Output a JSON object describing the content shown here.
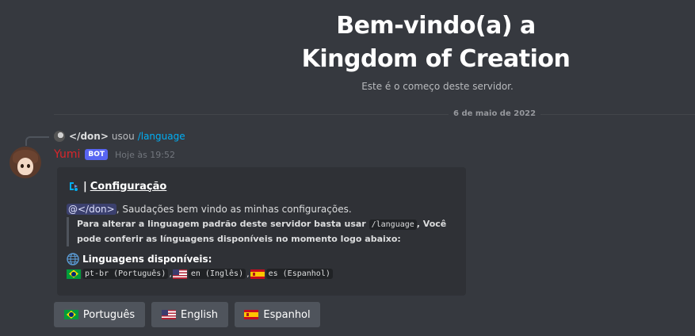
{
  "welcome": {
    "title_line1": "Bem-vindo(a) a",
    "title_line2": "Kingdom of Creation",
    "subtitle": "Este é o começo deste servidor."
  },
  "date_divider": "6 de maio de 2022",
  "reply": {
    "user": "</don>",
    "verb": "usou",
    "command": "/language"
  },
  "message": {
    "author": "Yumi",
    "bot_tag": "BOT",
    "timestamp": "Hoje às 19:52",
    "author_color": "#d9262b"
  },
  "embed": {
    "title_sep": "|",
    "title": "Configuração",
    "mention": "@</don>",
    "greeting": ", Saudações bem vindo as minhas configurações.",
    "quote_part1": "Para alterar a linguagem padrão deste servidor basta usar",
    "quote_code": "/language",
    "quote_part2": ", Você",
    "quote_line2": "pode conferir as línguagens disponíveis no momento logo abaixo:",
    "langs_title": "Linguagens disponíveis:",
    "langs": [
      {
        "code": "pt-br (Português)",
        "flag": "flag-br"
      },
      {
        "code": "en (Inglês)",
        "flag": "flag-us"
      },
      {
        "code": "es (Espanhol)",
        "flag": "flag-es"
      }
    ],
    "langs_sep": ","
  },
  "buttons": [
    {
      "label": "Português",
      "flag": "flag-br"
    },
    {
      "label": "English",
      "flag": "flag-us"
    },
    {
      "label": "Espanhol",
      "flag": "flag-es"
    }
  ],
  "colors": {
    "background": "#36393f",
    "embed": "#2f3136",
    "button": "#4f545c",
    "blurple": "#5865f2",
    "link": "#00aff4"
  }
}
